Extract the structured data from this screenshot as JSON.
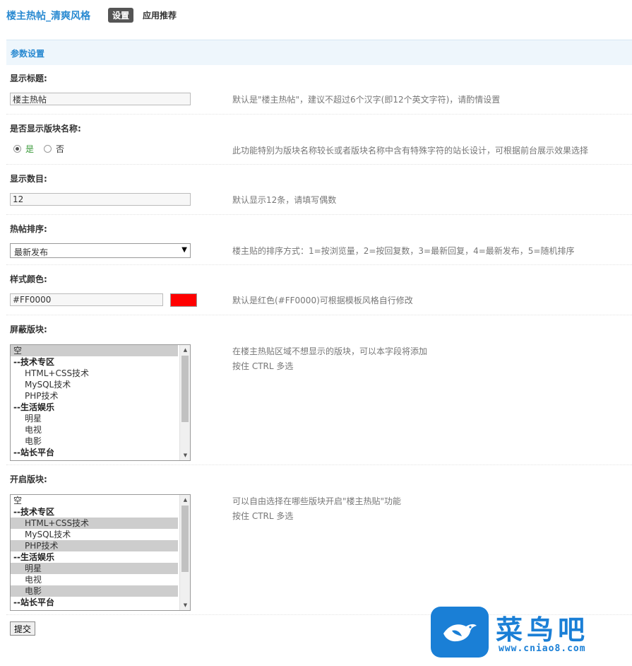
{
  "header": {
    "plugin_title": "楼主热帖_清爽风格",
    "tabs": [
      {
        "label": "设置",
        "active": true
      },
      {
        "label": "应用推荐",
        "active": false
      }
    ]
  },
  "section": {
    "title": "参数设置"
  },
  "fields": {
    "display_title": {
      "label": "显示标题:",
      "value": "楼主热帖",
      "tip": "默认是\"楼主热帖\"，建议不超过6个汉字(即12个英文字符)，请酌情设置"
    },
    "show_forum_name": {
      "label": "是否显示版块名称:",
      "options": [
        "是",
        "否"
      ],
      "selected": "是",
      "tip": "此功能特别为版块名称较长或者版块名称中含有特殊字符的站长设计，可根据前台展示效果选择"
    },
    "display_count": {
      "label": "显示数目:",
      "value": "12",
      "tip": "默认显示12条，请填写偶数"
    },
    "sort_order": {
      "label": "热帖排序:",
      "selected": "最新发布",
      "tip": "楼主贴的排序方式：1=按浏览量，2=按回复数，3=最新回复，4=最新发布，5=随机排序"
    },
    "style_color": {
      "label": "样式颜色:",
      "value": "#FF0000",
      "swatch": "#FF0000",
      "tip": "默认是红色(#FF0000)可根据模板风格自行修改"
    },
    "blocked_forums": {
      "label": "屏蔽版块:",
      "tip_line1": "在楼主热贴区域不想显示的版块，可以本字段将添加",
      "tip_line2": "按住 CTRL 多选",
      "options": [
        {
          "label": "空",
          "type": "normal",
          "selected": true
        },
        {
          "label": "--技术专区",
          "type": "group",
          "selected": false
        },
        {
          "label": "HTML+CSS技术",
          "type": "child",
          "selected": false
        },
        {
          "label": "MySQL技术",
          "type": "child",
          "selected": false
        },
        {
          "label": "PHP技术",
          "type": "child",
          "selected": false
        },
        {
          "label": "--生活娱乐",
          "type": "group",
          "selected": false
        },
        {
          "label": "明星",
          "type": "child",
          "selected": false
        },
        {
          "label": "电视",
          "type": "child",
          "selected": false
        },
        {
          "label": "电影",
          "type": "child",
          "selected": false
        },
        {
          "label": "--站长平台",
          "type": "group",
          "selected": false
        }
      ]
    },
    "enabled_forums": {
      "label": "开启版块:",
      "tip_line1": "可以自由选择在哪些版块开启\"楼主热贴\"功能",
      "tip_line2": "按住 CTRL 多选",
      "options": [
        {
          "label": "空",
          "type": "normal",
          "selected": false
        },
        {
          "label": "--技术专区",
          "type": "group",
          "selected": false
        },
        {
          "label": "HTML+CSS技术",
          "type": "child",
          "selected": true
        },
        {
          "label": "MySQL技术",
          "type": "child",
          "selected": false
        },
        {
          "label": "PHP技术",
          "type": "child",
          "selected": true
        },
        {
          "label": "--生活娱乐",
          "type": "group",
          "selected": false
        },
        {
          "label": "明星",
          "type": "child",
          "selected": true
        },
        {
          "label": "电视",
          "type": "child",
          "selected": false
        },
        {
          "label": "电影",
          "type": "child",
          "selected": true
        },
        {
          "label": "--站长平台",
          "type": "group",
          "selected": false
        }
      ]
    }
  },
  "submit_label": "提交",
  "watermark": {
    "brand": "菜鸟吧",
    "url": "www.cniao8.com",
    "color": "#1A7FD6"
  }
}
